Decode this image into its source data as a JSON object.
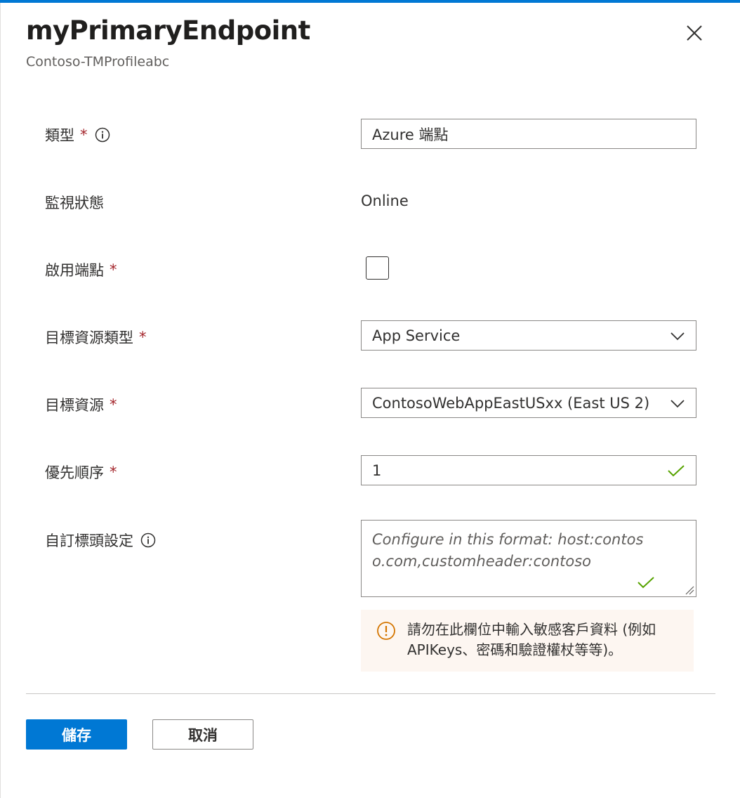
{
  "header": {
    "title": "myPrimaryEndpoint",
    "subtitle": "Contoso-TMProfileabc",
    "close_icon": "close-icon"
  },
  "form": {
    "type": {
      "label": "類型",
      "required_mark": "*",
      "value": "Azure 端點",
      "info_icon": "info-icon"
    },
    "monitor_status": {
      "label": "監視狀態",
      "value": "Online"
    },
    "enable_endpoint": {
      "label": "啟用端點",
      "required_mark": "*",
      "checked": false
    },
    "target_resource_type": {
      "label": "目標資源類型",
      "required_mark": "*",
      "value": "App Service",
      "icon": "chevron-down-icon"
    },
    "target_resource": {
      "label": "目標資源",
      "required_mark": "*",
      "value": "ContosoWebAppEastUSxx (East US 2)",
      "icon": "chevron-down-icon"
    },
    "priority": {
      "label": "優先順序",
      "required_mark": "*",
      "value": "1",
      "icon": "checkmark-icon"
    },
    "custom_headers": {
      "label": "自訂標頭設定",
      "info_icon": "info-icon",
      "placeholder": "Configure in this format: host:contoso.com,customheader:contoso",
      "icon": "checkmark-icon"
    },
    "warning": {
      "icon": "warning-icon",
      "text": "請勿在此欄位中輸入敏感客戶資料 (例如 APIKeys、密碼和驗證權杖等等)。"
    }
  },
  "footer": {
    "save_label": "儲存",
    "cancel_label": "取消"
  },
  "colors": {
    "accent": "#0078d4",
    "required": "#a4262c",
    "success": "#57a300",
    "warning": "#d47500",
    "warning_bg": "#fdf6f1"
  }
}
